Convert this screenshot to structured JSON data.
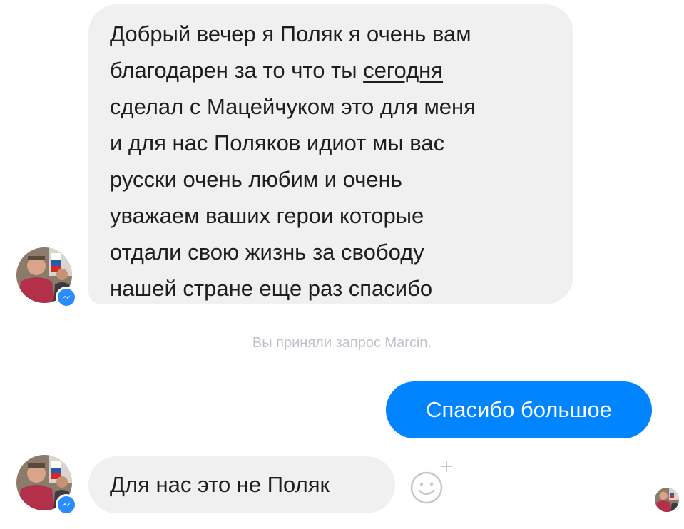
{
  "conversation": {
    "incoming_message_lines": [
      "Добрый вечер я Поляк я очень вам",
      "благодарен за то что ты ",
      "сделал с Мацейчуком это для меня",
      "и для нас Поляков идиот мы вас",
      "русски очень любим и очень",
      "уважаем ваших герои которые",
      "отдали свою жизнь за свободу",
      "нашей стране еще раз спасибо"
    ],
    "underlined_word": "сегодня",
    "system_note": "Вы приняли запрос Marcin.",
    "outgoing_message": "Спасибо большое",
    "incoming_reply": "Для нас это не Поляк"
  },
  "icons": {
    "sender_avatar": "avatar-photo",
    "messenger_badge": "messenger-badge-icon",
    "emoji_reaction": "smiley-add-reaction-icon",
    "read_receipt": "read-receipt-avatar"
  },
  "colors": {
    "incoming_bubble": "#f1f0f0",
    "outgoing_bubble": "#0084ff",
    "system_text": "#bec2c9",
    "badge": "#2a8cff"
  }
}
